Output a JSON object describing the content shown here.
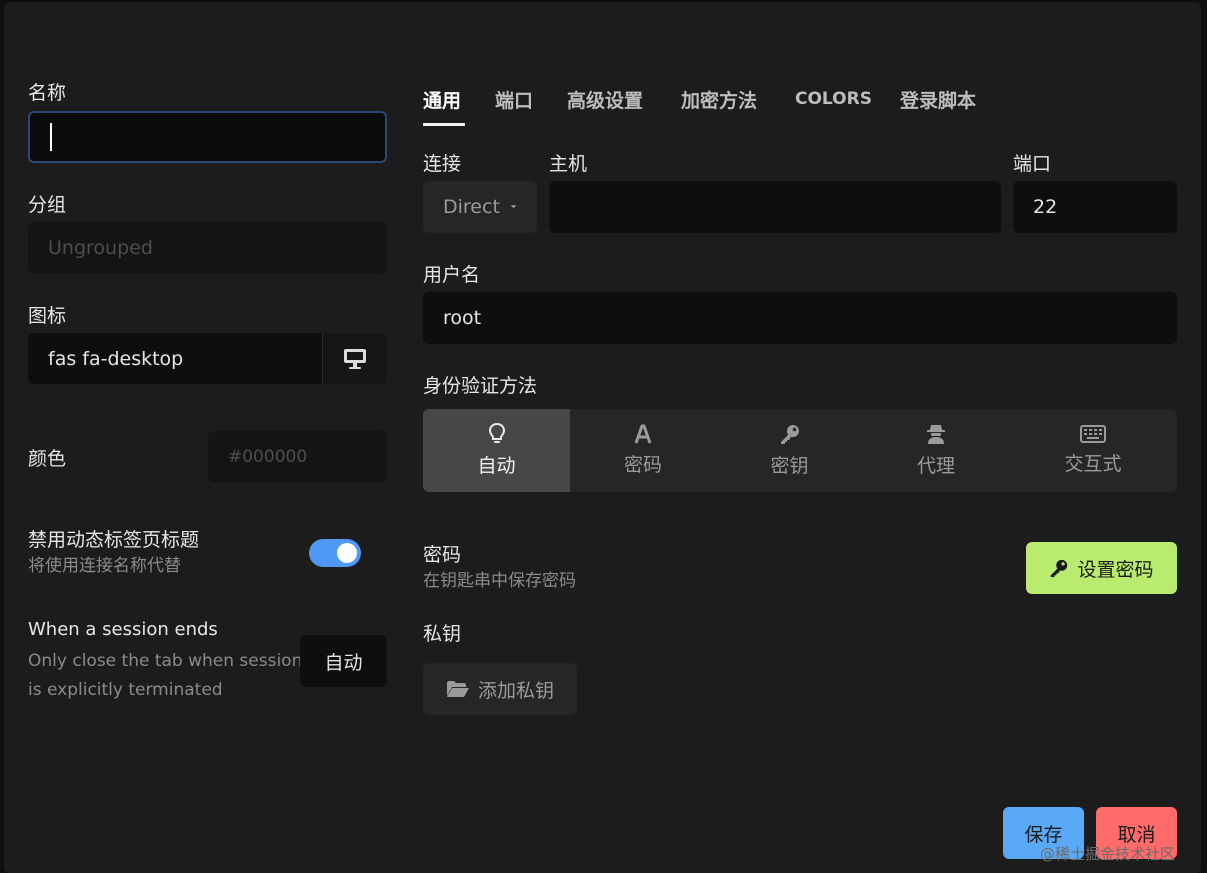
{
  "left": {
    "name_label": "名称",
    "group_label": "分组",
    "group_placeholder": "Ungrouped",
    "icon_label": "图标",
    "icon_value": "fas fa-desktop",
    "color_label": "颜色",
    "color_placeholder": "#000000",
    "dynamic_title_label": "禁用动态标签页标题",
    "dynamic_title_desc": "将使用连接名称代替",
    "dynamic_title_enabled": true,
    "session_end_label": "When a session ends",
    "session_end_desc_1": "Only close the tab when session",
    "session_end_desc_2": "is explicitly terminated",
    "session_end_button": "自动"
  },
  "tabs": [
    "通用",
    "端口",
    "高级设置",
    "加密方法",
    "COLORS",
    "登录脚本"
  ],
  "active_tab": "通用",
  "general": {
    "connection_label": "连接",
    "connection_value": "Direct",
    "host_label": "主机",
    "host_value": "",
    "port_label": "端口",
    "port_value": "22",
    "username_label": "用户名",
    "username_value": "root",
    "auth_label": "身份验证方法",
    "auth_methods": [
      {
        "label": "自动",
        "icon": "lightbulb-icon"
      },
      {
        "label": "密码",
        "icon": "font-icon"
      },
      {
        "label": "密钥",
        "icon": "key-icon"
      },
      {
        "label": "代理",
        "icon": "user-secret-icon"
      },
      {
        "label": "交互式",
        "icon": "keyboard-icon"
      }
    ],
    "active_auth": "自动",
    "password_label": "密码",
    "password_desc": "在钥匙串中保存密码",
    "set_password_button": "设置密码",
    "private_key_label": "私钥",
    "add_private_key_button": "添加私钥"
  },
  "footer": {
    "save": "保存",
    "cancel": "取消"
  },
  "watermark": "@稀土掘金技术社区",
  "colors": {
    "accent_blue": "#4f98f3",
    "set_password_green": "#b9ec6e",
    "cancel_red": "#ff6a6a",
    "save_blue": "#5aa9f6"
  }
}
